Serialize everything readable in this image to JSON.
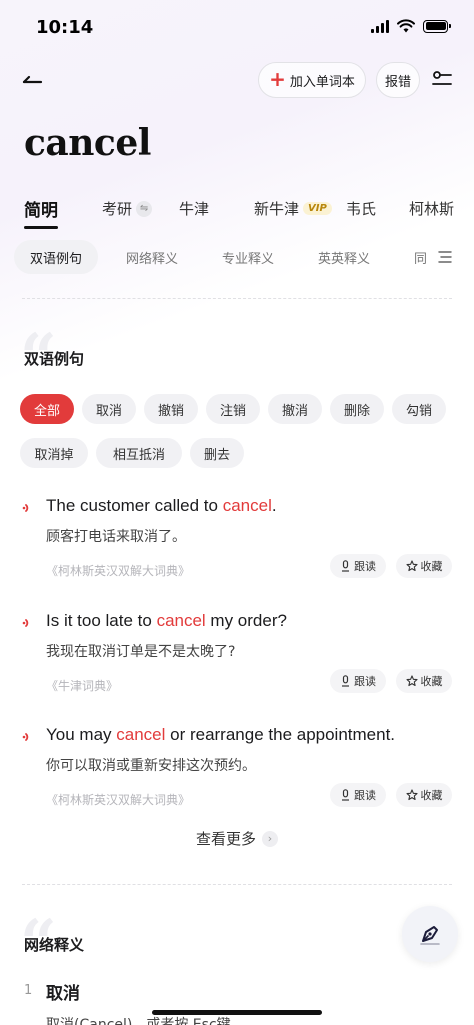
{
  "status_bar": {
    "time": "10:14"
  },
  "nav": {
    "add_label": "加入单词本",
    "report_label": "报错"
  },
  "headword": "cancel",
  "dict_tabs": [
    {
      "label": "简明"
    },
    {
      "label": "考研"
    },
    {
      "label": "牛津"
    },
    {
      "label": "新牛津",
      "badge": "VIP"
    },
    {
      "label": "韦氏"
    },
    {
      "label": "柯林斯"
    }
  ],
  "section_tabs": [
    {
      "label": "双语例句"
    },
    {
      "label": "网络释义"
    },
    {
      "label": "专业释义"
    },
    {
      "label": "英英释义"
    },
    {
      "label": "同"
    }
  ],
  "examples_section": {
    "title": "双语例句",
    "filters": [
      "全部",
      "取消",
      "撤销",
      "注销",
      "撤消",
      "删除",
      "勾销",
      "取消掉",
      "相互抵消",
      "删去"
    ],
    "items": [
      {
        "en_pre": "The customer called to ",
        "en_hl": "cancel",
        "en_post": ".",
        "zh": "顾客打电话来取消了。",
        "source": "《柯林斯英汉双解大词典》"
      },
      {
        "en_pre": "Is it too late to ",
        "en_hl": "cancel",
        "en_post": " my order?",
        "zh": "我现在取消订单是不是太晚了?",
        "source": "《牛津词典》"
      },
      {
        "en_pre": "You may ",
        "en_hl": "cancel",
        "en_post": " or rearrange the appointment.",
        "zh": "你可以取消或重新安排这次预约。",
        "source": "《柯林斯英汉双解大词典》"
      }
    ],
    "read_label": "跟读",
    "fav_label": "收藏",
    "more_label": "查看更多"
  },
  "web_section": {
    "title": "网络释义",
    "items": [
      {
        "num": "1",
        "word": "取消",
        "text": "取消(Cancel)，或者按 Esc键"
      }
    ]
  },
  "colors": {
    "accent": "#e23b3b",
    "chip_bg": "#f1f1f4"
  }
}
